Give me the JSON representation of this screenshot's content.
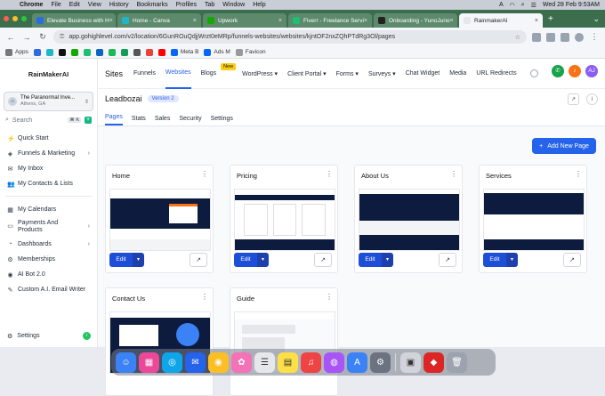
{
  "menubar": {
    "app": "Chrome",
    "items": [
      "File",
      "Edit",
      "View",
      "History",
      "Bookmarks",
      "Profiles",
      "Tab",
      "Window",
      "Help"
    ],
    "input_source": "A",
    "datetime": "Wed 28 Feb  9:53AM"
  },
  "tabs": [
    {
      "label": "Elevate Business with H",
      "color": "#2d6cdf"
    },
    {
      "label": "Home - Canva",
      "color": "#1fb6c9"
    },
    {
      "label": "Upwork",
      "color": "#14a800"
    },
    {
      "label": "Fiverr - Freelance Servi",
      "color": "#1dbf73"
    },
    {
      "label": "Onboarding - YunoJuno",
      "color": "#222222"
    },
    {
      "label": "RainmakerAI",
      "color": "#ffffff"
    }
  ],
  "address": {
    "url": "app.gohighlevel.com/v2/location/6GunROuQdjjWrzt0eMRp/funnels-websites/websites/kjntOF2nxZQhPTdRg3Ol/pages"
  },
  "bookmarks": {
    "apps_label": "Apps",
    "items": [
      "Meta B",
      "Ads M",
      "Favicon"
    ]
  },
  "sidebar": {
    "logo": "RainMakerAI",
    "account_name": "The Paranormal Inve...",
    "account_location": "Athens, GA",
    "search_placeholder": "Search",
    "search_kbd": "⌘ K",
    "items": [
      {
        "label": "Quick Start",
        "icon": "⚡"
      },
      {
        "label": "Funnels & Marketing",
        "icon": "◈",
        "chevron": "›"
      },
      {
        "label": "My Inbox",
        "icon": "✉"
      },
      {
        "label": "My Contacts & Lists",
        "icon": "👥"
      }
    ],
    "items2": [
      {
        "label": "My Calendars",
        "icon": "▦"
      },
      {
        "label": "Payments And Products",
        "icon": "▭",
        "chevron": "›"
      },
      {
        "label": "Dashboards",
        "icon": "◔",
        "chevron": "›"
      },
      {
        "label": "Memberships",
        "icon": "⚙"
      },
      {
        "label": "AI Bot 2.0",
        "icon": "◉"
      },
      {
        "label": "Custom A.I. Email Writer",
        "icon": "✎"
      }
    ],
    "settings": "Settings"
  },
  "topnav": {
    "title": "Sites",
    "items": [
      "Funnels",
      "Websites",
      "Blogs",
      "WordPress ▾",
      "Client Portal ▾",
      "Forms ▾",
      "Surveys ▾",
      "Chat Widget",
      "Media",
      "URL Redirects"
    ],
    "badge": "New",
    "user_initials": "AJ"
  },
  "funnel": {
    "name": "Leadbozai",
    "version": "Version 2"
  },
  "subtabs": [
    "Pages",
    "Stats",
    "Sales",
    "Security",
    "Settings"
  ],
  "add_page": "Add New Page",
  "cards": [
    {
      "title": "Home"
    },
    {
      "title": "Pricing"
    },
    {
      "title": "About Us"
    },
    {
      "title": "Services"
    },
    {
      "title": "Contact Us"
    },
    {
      "title": "Guide"
    }
  ],
  "card_actions": {
    "edit": "Edit"
  }
}
